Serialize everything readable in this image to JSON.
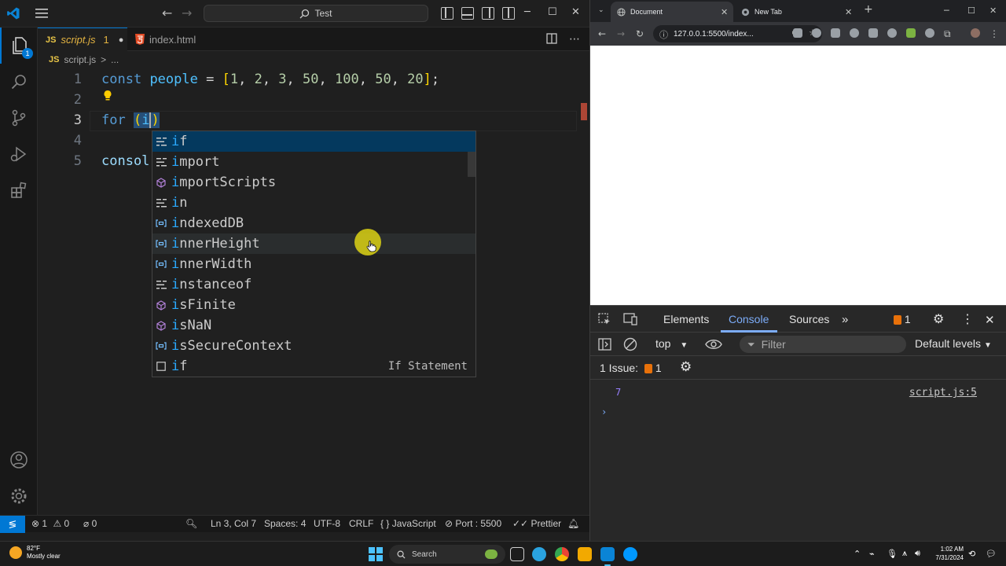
{
  "vscode": {
    "command_center": "Test",
    "activity_badge": "1",
    "tabs": [
      {
        "label": "script.js",
        "badge": "JS",
        "problems": "1",
        "dirty": "●"
      },
      {
        "label": "index.html"
      }
    ],
    "breadcrumb": {
      "file": "script.js",
      "badge": "JS",
      "sep": ">",
      "more": "..."
    },
    "lines": [
      "1",
      "2",
      "3",
      "4",
      "5"
    ],
    "code": {
      "line1": {
        "kw": "const",
        "var": "people",
        "eq": " = ",
        "open": "[",
        "nums": [
          "1",
          "2",
          "3",
          "50",
          "100",
          "50",
          "20"
        ],
        "close": "]",
        "semi": ";"
      },
      "line3": {
        "kw": "for",
        "open": "(",
        "typed": "i",
        "close": ")"
      },
      "line5": "consol"
    },
    "suggestions": [
      {
        "prefix": "i",
        "rest": "f",
        "kind": "keyword"
      },
      {
        "prefix": "i",
        "rest": "mport",
        "kind": "keyword"
      },
      {
        "prefix": "i",
        "rest": "mportScripts",
        "kind": "method"
      },
      {
        "prefix": "i",
        "rest": "n",
        "kind": "keyword"
      },
      {
        "prefix": "i",
        "rest": "ndexedDB",
        "kind": "variable"
      },
      {
        "prefix": "i",
        "rest": "nnerHeight",
        "kind": "variable"
      },
      {
        "prefix": "i",
        "rest": "nnerWidth",
        "kind": "variable"
      },
      {
        "prefix": "i",
        "rest": "nstanceof",
        "kind": "keyword"
      },
      {
        "prefix": "i",
        "rest": "sFinite",
        "kind": "method"
      },
      {
        "prefix": "i",
        "rest": "sNaN",
        "kind": "method"
      },
      {
        "prefix": "i",
        "rest": "sSecureContext",
        "kind": "variable"
      },
      {
        "prefix": "i",
        "rest": "f",
        "kind": "snippet",
        "detail": "If Statement"
      }
    ],
    "status": {
      "errors": "1",
      "warnings": "0",
      "ports": "0",
      "position": "Ln 3, Col 7",
      "spaces": "Spaces: 4",
      "encoding": "UTF-8",
      "eol": "CRLF",
      "language": "JavaScript",
      "port": "Port : 5500",
      "formatter": "Prettier"
    }
  },
  "chrome": {
    "tabs": [
      {
        "label": "Document"
      },
      {
        "label": "New Tab"
      }
    ],
    "url": "127.0.0.1:5500/index...",
    "devtools": {
      "tabs": [
        "Elements",
        "Console",
        "Sources"
      ],
      "issue_count": "1",
      "context": "top",
      "filter_placeholder": "Filter",
      "levels": "Default levels",
      "issues_label": "1 Issue:",
      "issues_count": "1",
      "console_output": [
        {
          "value": "7",
          "source": "script.js:5"
        }
      ],
      "prompt": "›"
    }
  },
  "taskbar": {
    "weather_temp": "82°F",
    "weather_desc": "Mostly clear",
    "search_label": "Search",
    "time": "1:02 AM",
    "date": "7/31/2024"
  },
  "colors": {
    "accent": "#0078d4",
    "keyword": "#569cd6",
    "variable": "#4fc1ff",
    "number": "#b5cea8",
    "suggest_highlight": "#2aaaff",
    "console_number": "#9980ff"
  }
}
